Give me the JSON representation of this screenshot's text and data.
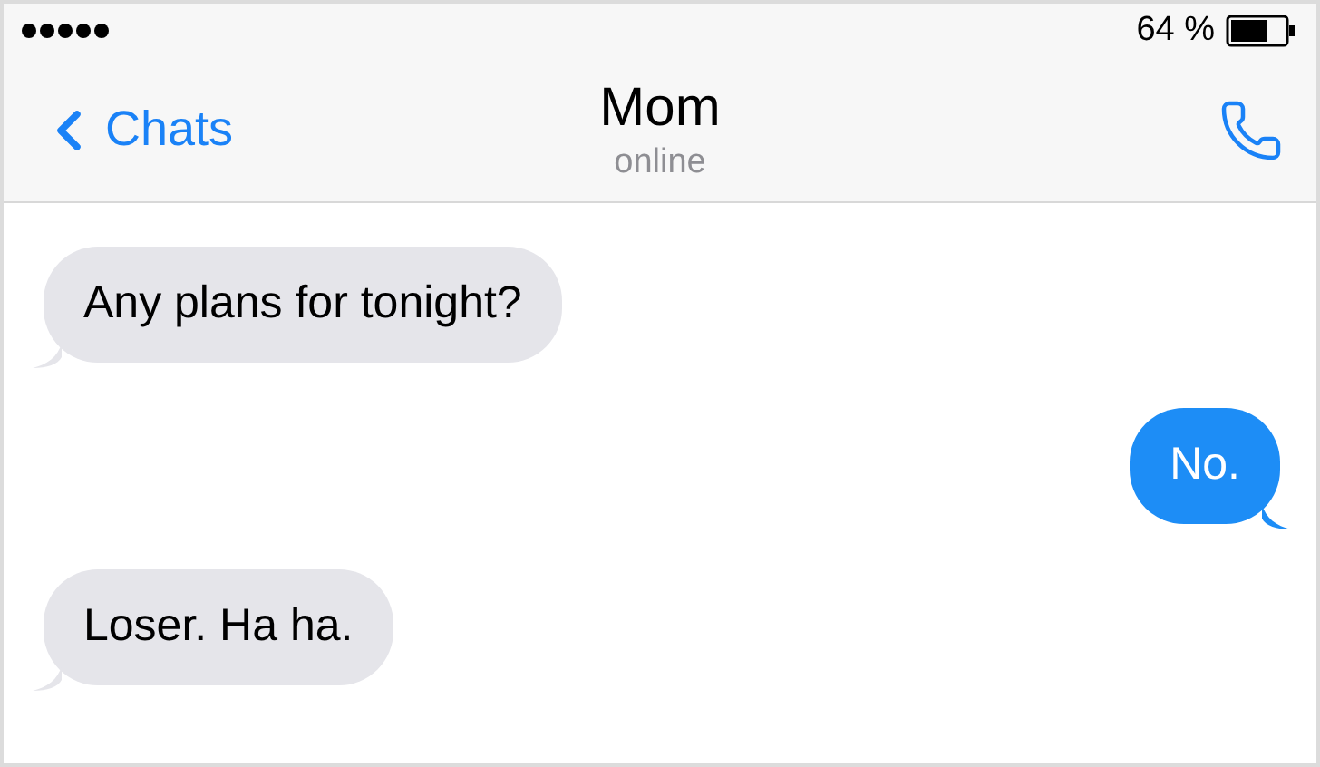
{
  "status_bar": {
    "battery": "64 %"
  },
  "nav": {
    "back": "Chats",
    "title": "Mom",
    "subtitle": "online"
  },
  "messages": [
    {
      "kind": "incoming",
      "text": "Any plans for tonight?"
    },
    {
      "kind": "outgoing",
      "text": "No."
    },
    {
      "kind": "incoming",
      "text": "Loser. Ha ha."
    }
  ]
}
